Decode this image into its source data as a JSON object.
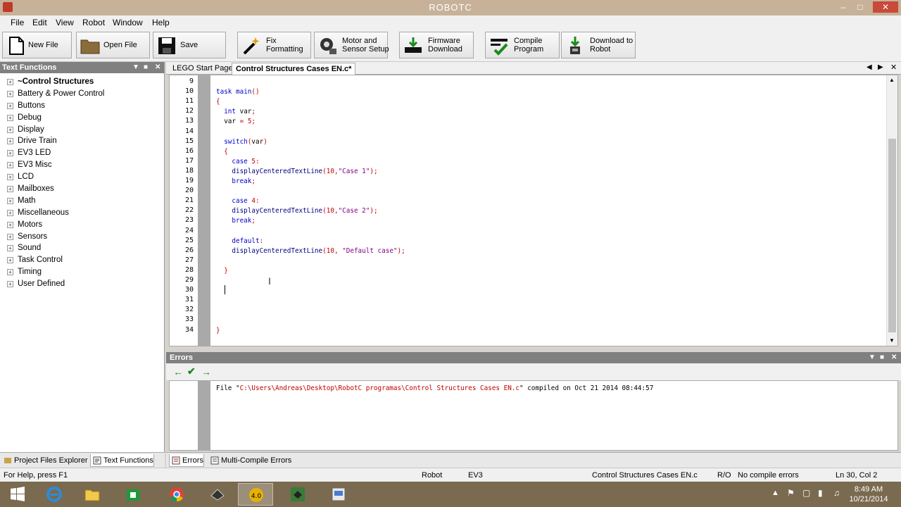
{
  "window": {
    "title": "ROBOTC"
  },
  "menu": [
    "File",
    "Edit",
    "View",
    "Robot",
    "Window",
    "Help"
  ],
  "toolbar": [
    {
      "id": "new-file",
      "label": "New File",
      "icon": "new-file-icon"
    },
    {
      "id": "open-file",
      "label": "Open File",
      "icon": "folder-icon"
    },
    {
      "id": "save",
      "label": "Save",
      "icon": "floppy-disk-icon"
    },
    {
      "id": "fix-formatting",
      "label": "Fix Formatting",
      "icon": "magic-wand-icon"
    },
    {
      "id": "motor-sensor-setup",
      "label": "Motor and\nSensor Setup",
      "icon": "motor-icon"
    },
    {
      "id": "firmware-download",
      "label": "Firmware\nDownload",
      "icon": "firmware-icon"
    },
    {
      "id": "compile-program",
      "label": "Compile\nProgram",
      "icon": "compile-check-icon"
    },
    {
      "id": "download-to-robot",
      "label": "Download to\nRobot",
      "icon": "download-robot-icon"
    }
  ],
  "left_panel": {
    "title": "Text Functions",
    "items": [
      "~Control Structures",
      "Battery & Power Control",
      "Buttons",
      "Debug",
      "Display",
      "Drive Train",
      "EV3 LED",
      "EV3 Misc",
      "LCD",
      "Mailboxes",
      "Math",
      "Miscellaneous",
      "Motors",
      "Sensors",
      "Sound",
      "Task Control",
      "Timing",
      "User Defined"
    ],
    "tabs": [
      "Project Files Explorer",
      "Text Functions"
    ]
  },
  "editor": {
    "tabs": [
      "LEGO Start Page",
      "Control Structures Cases EN.c*"
    ],
    "line_numbers": [
      "9",
      "10",
      "11",
      "12",
      "13",
      "14",
      "15",
      "16",
      "17",
      "18",
      "19",
      "20",
      "21",
      "22",
      "23",
      "24",
      "25",
      "26",
      "27",
      "28",
      "29",
      "30",
      "31",
      "32",
      "33",
      "34"
    ],
    "lines": [
      "",
      "task main()",
      "{",
      "  int var;",
      "  var = 5;",
      "",
      "  switch(var)",
      "  {",
      "    case 5:",
      "    displayCenteredTextLine(10,\"Case 1\");",
      "    break;",
      "",
      "    case 4:",
      "    displayCenteredTextLine(10,\"Case 2\");",
      "    break;",
      "",
      "    default:",
      "    displayCenteredTextLine(10, \"Default case\");",
      "",
      "  }",
      "",
      "",
      "",
      "",
      "",
      "}"
    ]
  },
  "errors_panel": {
    "title": "Errors",
    "message_prefix": "File \"",
    "message_path": "C:\\Users\\Andreas\\Desktop\\RobotC programas\\Control Structures Cases EN.c",
    "message_suffix": "\" compiled on Oct 21 2014 08:44:57",
    "tabs": [
      "Errors",
      "Multi-Compile Errors"
    ]
  },
  "statusbar": {
    "help": "For Help, press F1",
    "robot": "Robot",
    "platform": "EV3",
    "file": "Control Structures Cases EN.c",
    "mode": "R/O",
    "compile_status": "No compile errors",
    "position": "Ln 30, Col 2"
  },
  "taskbar": {
    "time": "8:49 AM",
    "date": "10/21/2014"
  }
}
